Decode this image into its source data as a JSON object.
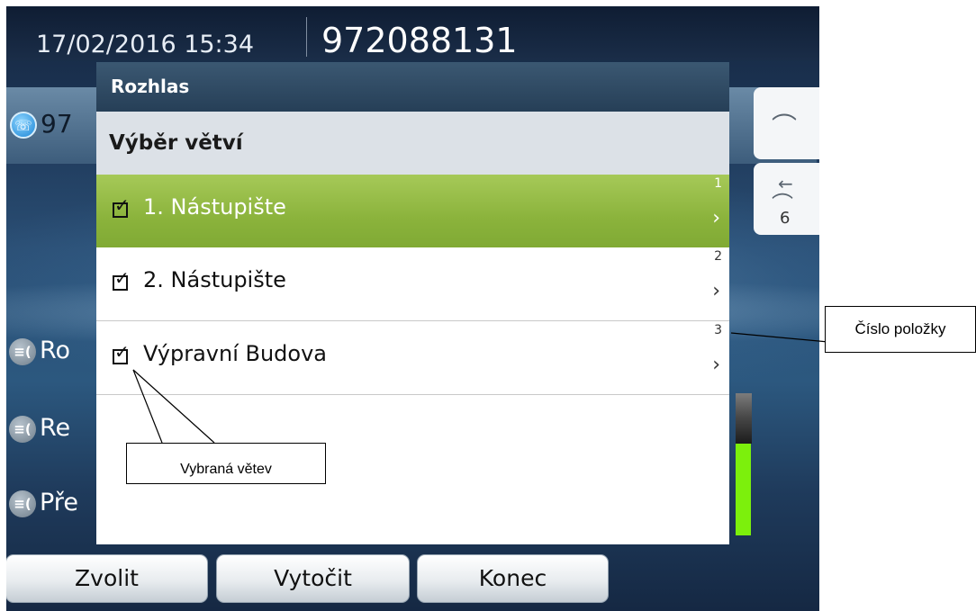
{
  "status_bar": {
    "datetime": "17/02/2016 15:34",
    "number": "972088131"
  },
  "background": {
    "active_line": {
      "text": "97",
      "icon": "phone-handset-icon"
    },
    "items": [
      {
        "text": "Ro",
        "icon": "intercom-icon"
      },
      {
        "text": "Re",
        "icon": "intercom-icon"
      },
      {
        "text": "Pře",
        "icon": "intercom-icon"
      }
    ],
    "right_softkeys": [
      {
        "icon": "hangup-icon"
      },
      {
        "icon": "callback-icon",
        "count": "6"
      }
    ]
  },
  "popup": {
    "title": "Rozhlas",
    "subtitle": "Výběr větví",
    "items": [
      {
        "num": "1",
        "label": "1. Nástupište",
        "checked": true,
        "selected": true
      },
      {
        "num": "2",
        "label": "2. Nástupište",
        "checked": true,
        "selected": false
      },
      {
        "num": "3",
        "label": "Výpravní Budova",
        "checked": true,
        "selected": false
      }
    ]
  },
  "softkeys": [
    {
      "label": "Zvolit"
    },
    {
      "label": "Vytočit"
    },
    {
      "label": "Konec"
    }
  ],
  "annotations": {
    "item_number": "Číslo položky",
    "selected_branch": "Vybraná větev"
  },
  "colors": {
    "selected_row": "#8bb33c",
    "header": "#2f4a63",
    "accent_green": "#7cf00c"
  },
  "glyphs": {
    "check": "✓",
    "chevron": "›",
    "arrow_left": "←",
    "handset": "☎"
  }
}
